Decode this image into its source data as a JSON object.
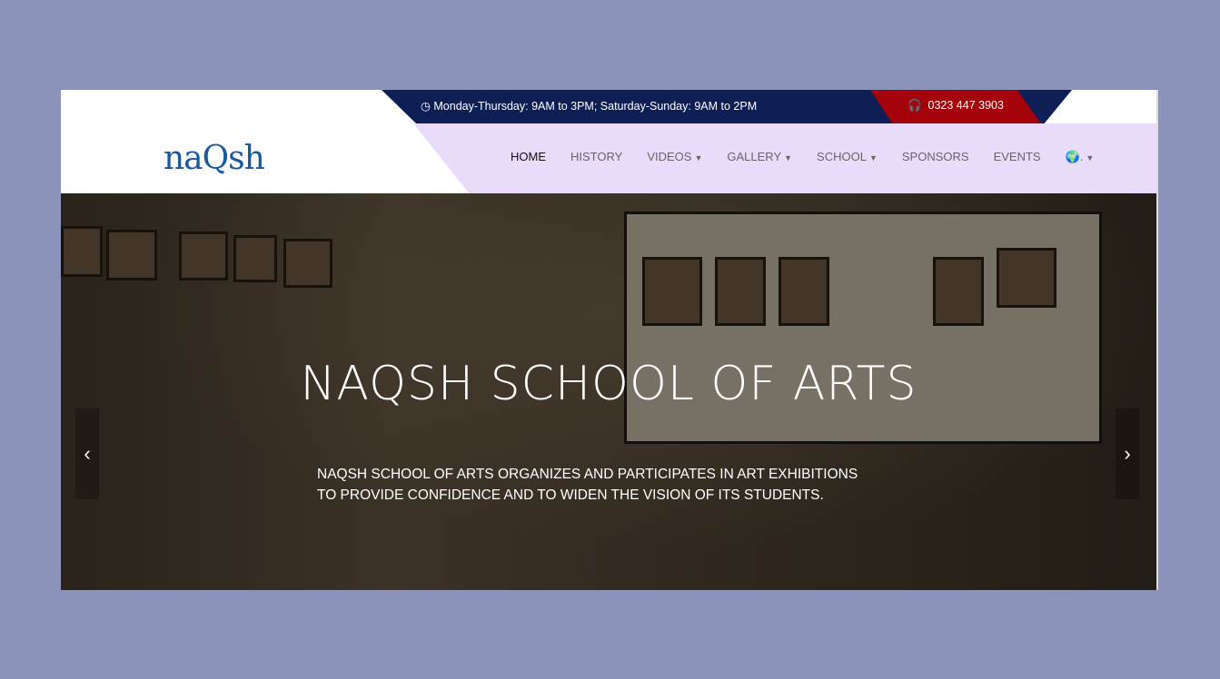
{
  "topbar": {
    "hours": "Monday-Thursday: 9AM to 3PM; Saturday-Sunday: 9AM to 2PM",
    "phone": "0323 447 3903"
  },
  "logo": "naQsh",
  "nav": [
    "HOME",
    "HISTORY",
    "VIDEOS",
    "GALLERY",
    "SCHOOL",
    "SPONSORS",
    "EVENTS"
  ],
  "language_label": ".",
  "hero": {
    "title": "NAQSH SCHOOL OF ARTS",
    "line1": "NAQSH SCHOOL OF ARTS ORGANIZES AND PARTICIPATES IN ART EXHIBITIONS",
    "line2": "TO PROVIDE CONFIDENCE AND TO WIDEN THE VISION OF ITS STUDENTS.",
    "prev": "‹",
    "next": "›"
  }
}
